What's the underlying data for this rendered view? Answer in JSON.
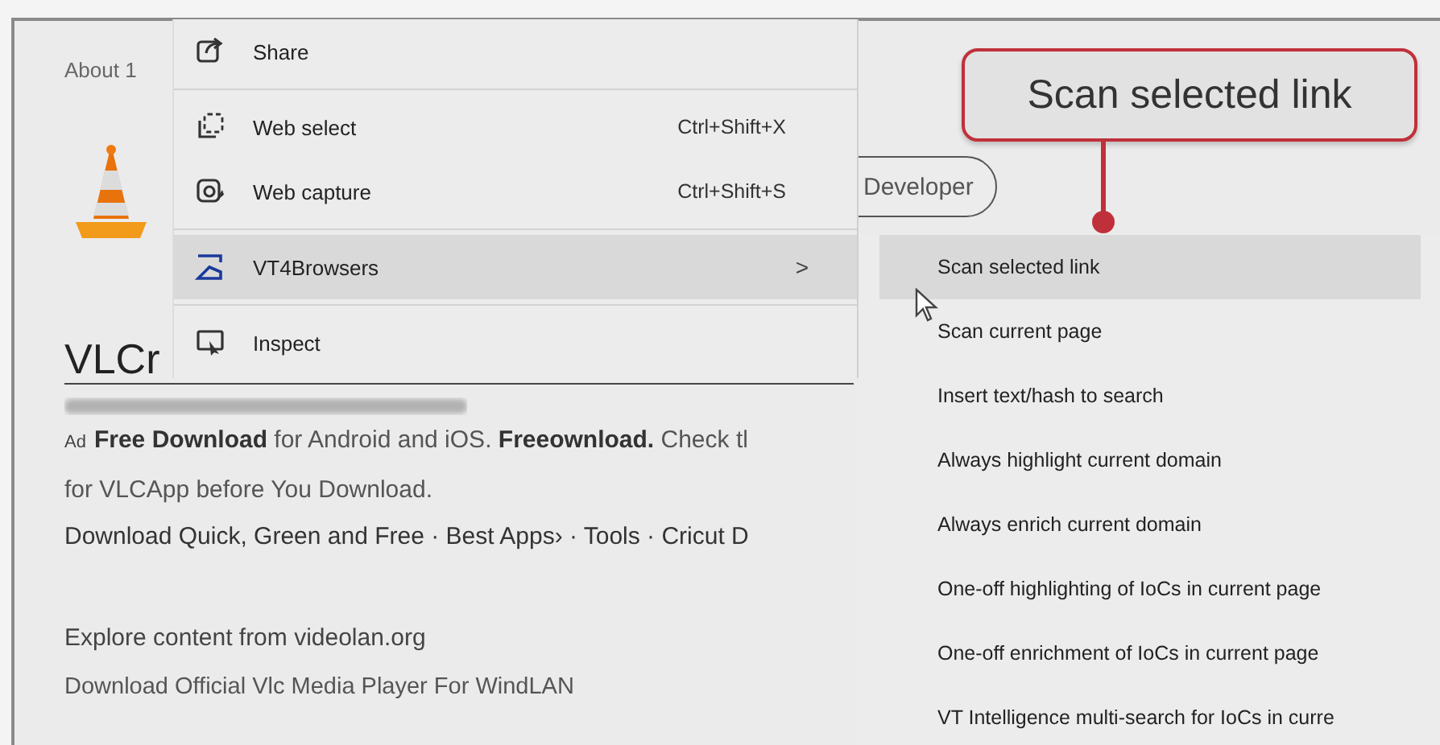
{
  "results_header": "About 1",
  "result": {
    "title": "VLCr",
    "ad_label": "Ad",
    "description": [
      "**Free Download** for Android and iOS. **Freeownload.** Check tl",
      "for VLCApp before You Download."
    ],
    "sitelinks": "Download Quick, Green and Free · Best Apps› · Tools · Cricut D"
  },
  "section": {
    "title": "Explore content from videolan.org",
    "subtitle": "Download Official Vlc Media Player For WindLAN"
  },
  "filter_pill": {
    "label": "Developer"
  },
  "context_menu": {
    "items": [
      {
        "kind": "share",
        "label": "Share",
        "selected": false
      },
      {
        "kind": "separator"
      },
      {
        "kind": "select",
        "label": "Web select",
        "shortcut": "Ctrl+Shift+X",
        "selected": false
      },
      {
        "kind": "capture",
        "label": "Web capture",
        "shortcut": "Ctrl+Shift+S",
        "selected": false
      },
      {
        "kind": "separator"
      },
      {
        "kind": "extension",
        "label": "VT4Browsers",
        "arrow": ">",
        "selected": true
      },
      {
        "kind": "separator"
      },
      {
        "kind": "inspect",
        "label": "Inspect",
        "selected": false
      }
    ]
  },
  "submenu": {
    "items": [
      {
        "label": "Scan selected link",
        "selected": true
      },
      {
        "label": "Scan current page",
        "selected": false
      },
      {
        "label": "Insert text/hash to search",
        "selected": false
      },
      {
        "label": "Always highlight current domain",
        "selected": false
      },
      {
        "label": "Always enrich current domain",
        "selected": false
      },
      {
        "label": "One-off highlighting of IoCs in current page",
        "selected": false
      },
      {
        "label": "One-off enrichment of IoCs in current page",
        "selected": false
      },
      {
        "label": "VT Intelligence multi-search for IoCs in curre",
        "selected": false
      }
    ]
  },
  "callout": {
    "text": "Scan selected link"
  }
}
